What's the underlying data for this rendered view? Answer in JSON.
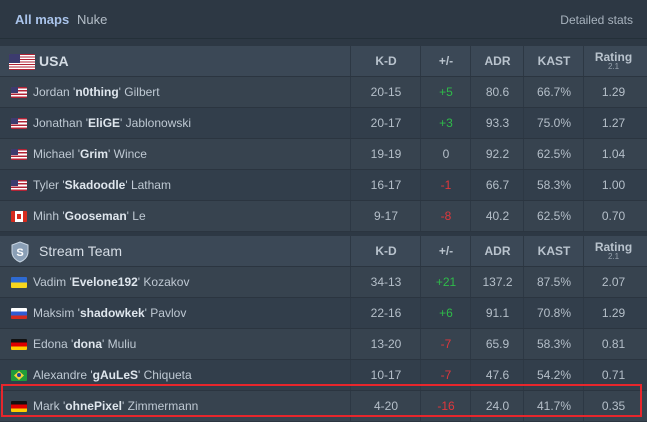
{
  "tabs": {
    "all_maps": "All maps",
    "nuke": "Nuke",
    "detailed_stats": "Detailed stats"
  },
  "columns": {
    "kd": "K-D",
    "pm": "+/-",
    "adr": "ADR",
    "kast": "KAST",
    "rating": "Rating",
    "rating_sub": "2.1"
  },
  "teams": [
    {
      "name": "USA",
      "logo": "usa-flag-icon",
      "players": [
        {
          "flag": "us",
          "first": "Jordan",
          "nick": "n0thing",
          "last": "Gilbert",
          "kd": "20-15",
          "pm": "+5",
          "adr": "80.6",
          "kast": "66.7%",
          "rating": "1.29"
        },
        {
          "flag": "us",
          "first": "Jonathan",
          "nick": "EliGE",
          "last": "Jablonowski",
          "kd": "20-17",
          "pm": "+3",
          "adr": "93.3",
          "kast": "75.0%",
          "rating": "1.27"
        },
        {
          "flag": "us",
          "first": "Michael",
          "nick": "Grim",
          "last": "Wince",
          "kd": "19-19",
          "pm": "0",
          "adr": "92.2",
          "kast": "62.5%",
          "rating": "1.04"
        },
        {
          "flag": "us",
          "first": "Tyler",
          "nick": "Skadoodle",
          "last": "Latham",
          "kd": "16-17",
          "pm": "-1",
          "adr": "66.7",
          "kast": "58.3%",
          "rating": "1.00"
        },
        {
          "flag": "ca",
          "first": "Minh",
          "nick": "Gooseman",
          "last": "Le",
          "kd": "9-17",
          "pm": "-8",
          "adr": "40.2",
          "kast": "62.5%",
          "rating": "0.70"
        }
      ]
    },
    {
      "name": "Stream Team",
      "logo": "shield-icon",
      "players": [
        {
          "flag": "ua",
          "first": "Vadim",
          "nick": "Evelone192",
          "last": "Kozakov",
          "kd": "34-13",
          "pm": "+21",
          "adr": "137.2",
          "kast": "87.5%",
          "rating": "2.07"
        },
        {
          "flag": "ru",
          "first": "Maksim",
          "nick": "shadowkek",
          "last": "Pavlov",
          "kd": "22-16",
          "pm": "+6",
          "adr": "91.1",
          "kast": "70.8%",
          "rating": "1.29"
        },
        {
          "flag": "de",
          "first": "Edona",
          "nick": "dona",
          "last": "Muliu",
          "kd": "13-20",
          "pm": "-7",
          "adr": "65.9",
          "kast": "58.3%",
          "rating": "0.81"
        },
        {
          "flag": "br",
          "first": "Alexandre",
          "nick": "gAuLeS",
          "last": "Chiqueta",
          "kd": "10-17",
          "pm": "-7",
          "adr": "47.6",
          "kast": "54.2%",
          "rating": "0.71"
        },
        {
          "flag": "de",
          "first": "Mark",
          "nick": "ohnePixel",
          "last": "Zimmermann",
          "kd": "4-20",
          "pm": "-16",
          "adr": "24.0",
          "kast": "41.7%",
          "rating": "0.35"
        }
      ]
    }
  ],
  "colors": {
    "positive": "#2fbb4a",
    "negative": "#e0373c",
    "highlight": "#e8262c",
    "active_tab": "#a9c3ea"
  }
}
